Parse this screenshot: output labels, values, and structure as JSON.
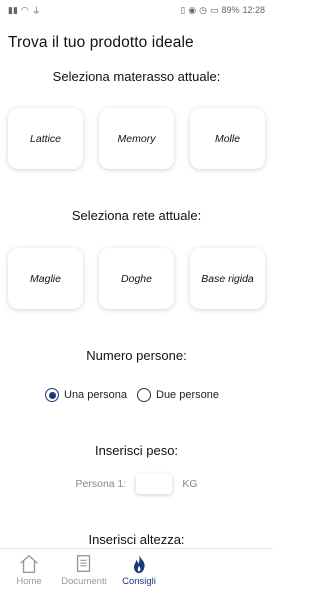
{
  "status_bar": {
    "battery": "89%",
    "time": "12:28"
  },
  "page": {
    "title": "Trova il tuo prodotto ideale"
  },
  "mattress": {
    "heading": "Seleziona materasso attuale:",
    "options": [
      "Lattice",
      "Memory",
      "Molle"
    ]
  },
  "base": {
    "heading": "Seleziona rete attuale:",
    "options": [
      "Maglie",
      "Doghe",
      "Base rigida"
    ]
  },
  "people": {
    "heading": "Numero persone:",
    "options": [
      {
        "label": "Una persona",
        "selected": true
      },
      {
        "label": "Due persone",
        "selected": false
      }
    ]
  },
  "weight": {
    "heading": "Inserisci peso:",
    "field_label": "Persona 1:",
    "value": "",
    "unit": "KG"
  },
  "height": {
    "heading": "Inserisci altezza:"
  },
  "bottom_nav": {
    "items": [
      {
        "label": "Home",
        "icon": "home-icon",
        "active": false
      },
      {
        "label": "Documenti",
        "icon": "document-icon",
        "active": false
      },
      {
        "label": "Consigli",
        "icon": "flame-icon",
        "active": true
      }
    ]
  },
  "colors": {
    "accent": "#1b3a7a",
    "inactive": "#999999"
  }
}
